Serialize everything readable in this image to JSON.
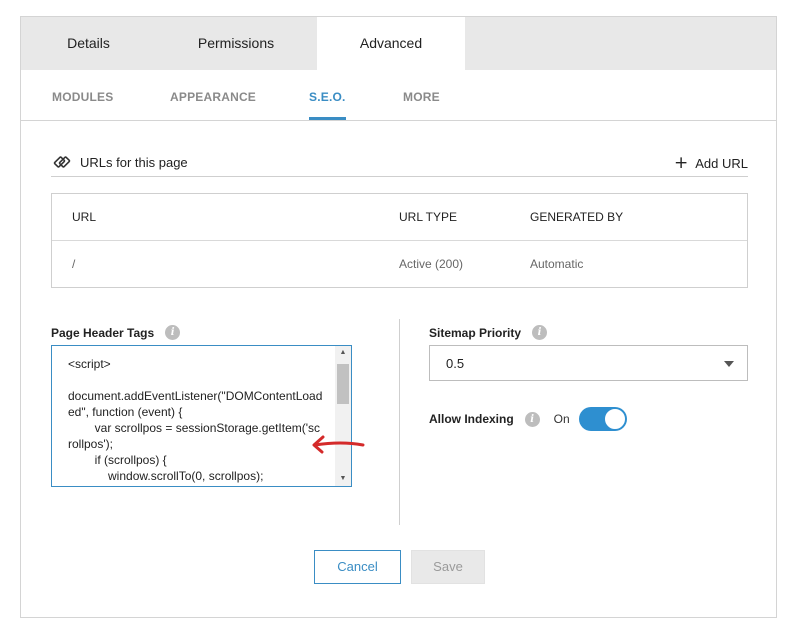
{
  "tabs": [
    {
      "label": "Details"
    },
    {
      "label": "Permissions"
    },
    {
      "label": "Advanced"
    }
  ],
  "sub_tabs": [
    {
      "label": "MODULES"
    },
    {
      "label": "APPEARANCE"
    },
    {
      "label": "S.E.O."
    },
    {
      "label": "MORE"
    }
  ],
  "active_sub_tab": "S.E.O.",
  "urls": {
    "title": "URLs for this page",
    "add_label": "Add URL",
    "columns": [
      "URL",
      "URL TYPE",
      "GENERATED BY"
    ],
    "rows": [
      {
        "url": "/",
        "type": "Active (200)",
        "generated_by": "Automatic"
      }
    ]
  },
  "page_header_tags": {
    "label": "Page Header Tags",
    "value": "<script>\n\ndocument.addEventListener(\"DOMContentLoaded\", function (event) {\n        var scrollpos = sessionStorage.getItem('scrollpos');\n        if (scrollpos) {\n            window.scrollTo(0, scrollpos);"
  },
  "sitemap_priority": {
    "label": "Sitemap Priority",
    "value": "0.5"
  },
  "allow_indexing": {
    "label": "Allow Indexing",
    "state_label": "On",
    "enabled": true
  },
  "buttons": {
    "cancel": "Cancel",
    "save": "Save"
  },
  "colors": {
    "accent": "#3a8dc4",
    "toggle": "#2e8fd0",
    "annotation": "#d42a2a"
  },
  "icons": [
    "link-icon",
    "plus-icon",
    "info-icon",
    "chevron-down-icon",
    "scroll-up-arrow-icon",
    "scroll-down-arrow-icon"
  ]
}
